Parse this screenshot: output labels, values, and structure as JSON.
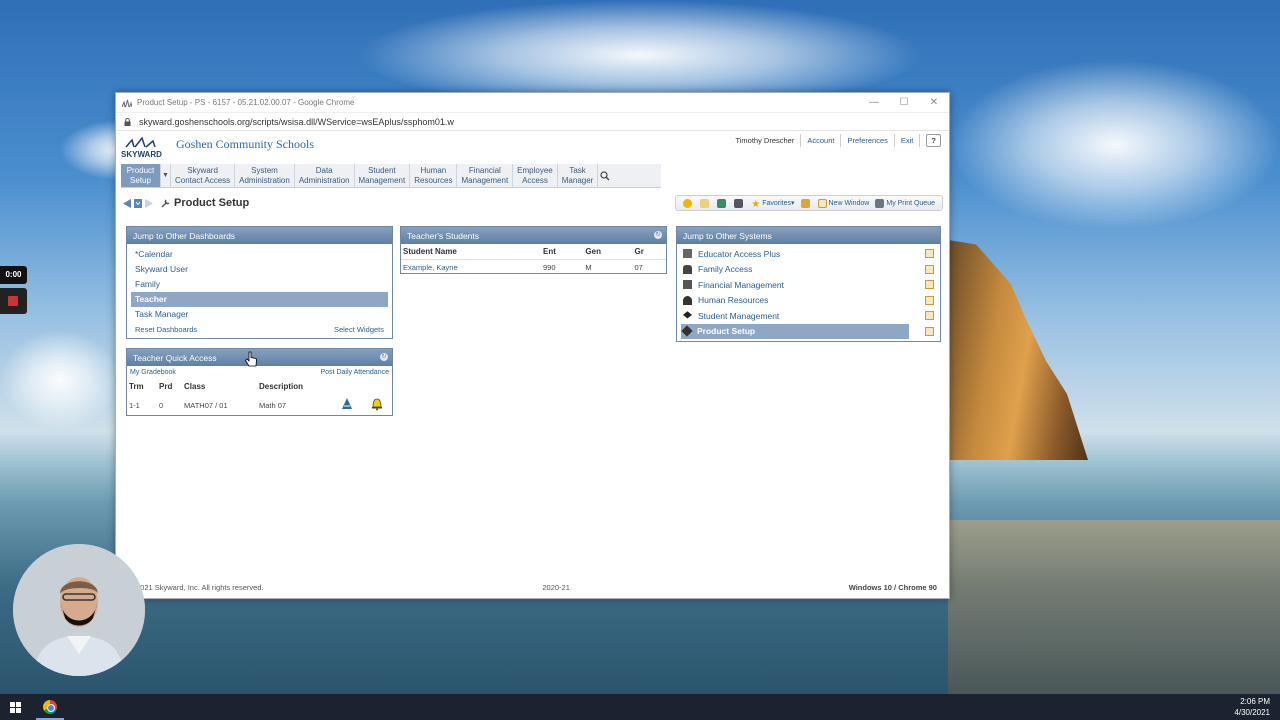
{
  "window": {
    "title": "Product Setup - PS - 6157 - 05.21.02.00.07 - Google Chrome",
    "url": "skyward.goshenschools.org/scripts/wsisa.dll/WService=wsEAplus/ssphom01.w",
    "controls": [
      "—",
      "☐",
      "✕"
    ]
  },
  "header": {
    "school_name": "Goshen Community Schools",
    "logo_text": "SKYWARD",
    "user_name": "Timothy Drescher",
    "account": "Account",
    "preferences": "Preferences",
    "exit": "Exit",
    "help": "?"
  },
  "menu": {
    "items": [
      {
        "line1": "Product",
        "line2": "Setup"
      },
      {
        "line1": "Skyward",
        "line2": "Contact Access"
      },
      {
        "line1": "System",
        "line2": "Administration"
      },
      {
        "line1": "Data",
        "line2": "Administration"
      },
      {
        "line1": "Student",
        "line2": "Management"
      },
      {
        "line1": "Human",
        "line2": "Resources"
      },
      {
        "line1": "Financial",
        "line2": "Management"
      },
      {
        "line1": "Employee",
        "line2": "Access"
      },
      {
        "line1": "Task",
        "line2": "Manager"
      }
    ]
  },
  "page": {
    "title": "Product Setup"
  },
  "toolbar": {
    "favorites": "Favorites",
    "new_window": "New Window",
    "print_queue": "My Print Queue"
  },
  "dashboards": {
    "title": "Jump to Other Dashboards",
    "items": [
      "*Calendar",
      "Skyward User",
      "Family",
      "Teacher",
      "Task Manager"
    ],
    "reset": "Reset Dashboards",
    "select_widgets": "Select Widgets"
  },
  "students": {
    "title": "Teacher's Students",
    "headers": [
      "Student Name",
      "Ent",
      "Gen",
      "Gr"
    ],
    "rows": [
      {
        "name": "Example, Kayne",
        "ent": "990",
        "gen": "M",
        "gr": "07"
      }
    ]
  },
  "systems": {
    "title": "Jump to Other Systems",
    "items": [
      "Educator Access Plus",
      "Family Access",
      "Financial Management",
      "Human Resources",
      "Student Management",
      "Product Setup"
    ]
  },
  "quick_access": {
    "title": "Teacher Quick Access",
    "gradebook": "My Gradebook",
    "attendance": "Post Daily Attendance",
    "headers": [
      "Trm",
      "Prd",
      "Class",
      "Description"
    ],
    "rows": [
      {
        "trm": "1-1",
        "prd": "0",
        "class": "MATH07 / 01",
        "desc": "Math 07"
      }
    ]
  },
  "footer": {
    "copyright": "2021 Skyward, Inc. All rights reserved.",
    "year": "2020-21",
    "platform": "Windows 10 / Chrome 90"
  },
  "taskbar": {
    "time": "2:06 PM",
    "date": "4/30/2021"
  },
  "recorder": {
    "timer": "0:00"
  }
}
